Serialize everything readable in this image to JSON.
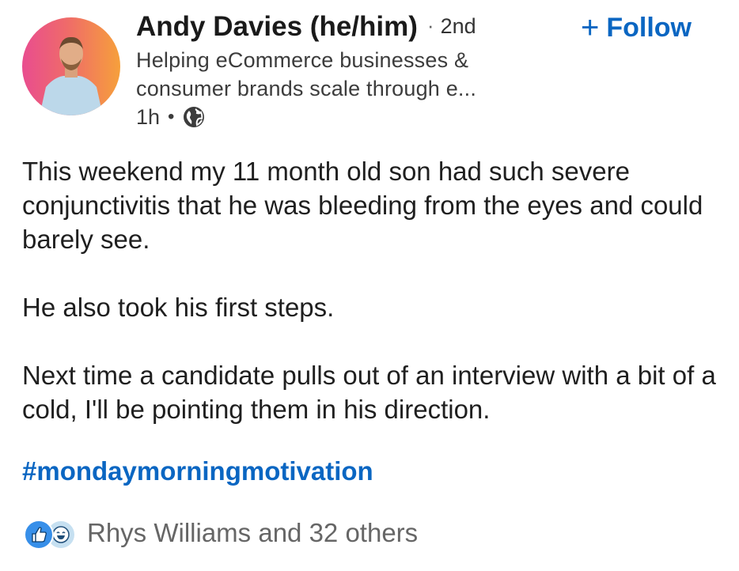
{
  "author": {
    "name": "Andy Davies (he/him)",
    "separator": "·",
    "degree": "2nd",
    "headline": "Helping eCommerce businesses & consumer brands scale through e...",
    "posted_time": "1h",
    "meta_separator": "•",
    "visibility_icon": "globe-icon",
    "avatar": "avatar"
  },
  "follow": {
    "plus": "+",
    "label": "Follow"
  },
  "post": {
    "paragraphs": [
      "This weekend my 11 month old son had such severe conjunctivitis that he was bleeding from the eyes and could barely see.",
      "He also took his first steps.",
      "Next time a candidate pulls out of an interview with a bit of a cold, I'll be pointing them in his direction."
    ],
    "hashtag": "#mondaymorningmotivation"
  },
  "reactions": {
    "icons": [
      "like-icon",
      "funny-icon"
    ],
    "summary": "Rhys Williams and 32 others"
  },
  "colors": {
    "accent": "#0a66c2",
    "like": "#378fe9",
    "muted_text": "#666666"
  }
}
